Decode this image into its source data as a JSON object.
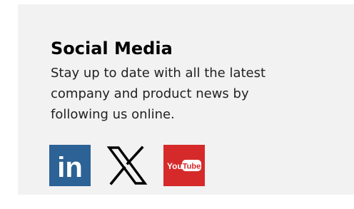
{
  "social": {
    "title": "Social Media",
    "description": "Stay up to date with all the latest company and product news by following us online.",
    "icons": [
      {
        "name": "linkedin-icon",
        "text": "in",
        "color": "#2c6296"
      },
      {
        "name": "x-icon",
        "color": "#000000"
      },
      {
        "name": "youtube-icon",
        "you": "You",
        "tube": "Tube",
        "color": "#d62a2a"
      }
    ]
  },
  "colors": {
    "panel_background": "#f2f2f2",
    "text": "#000000"
  }
}
